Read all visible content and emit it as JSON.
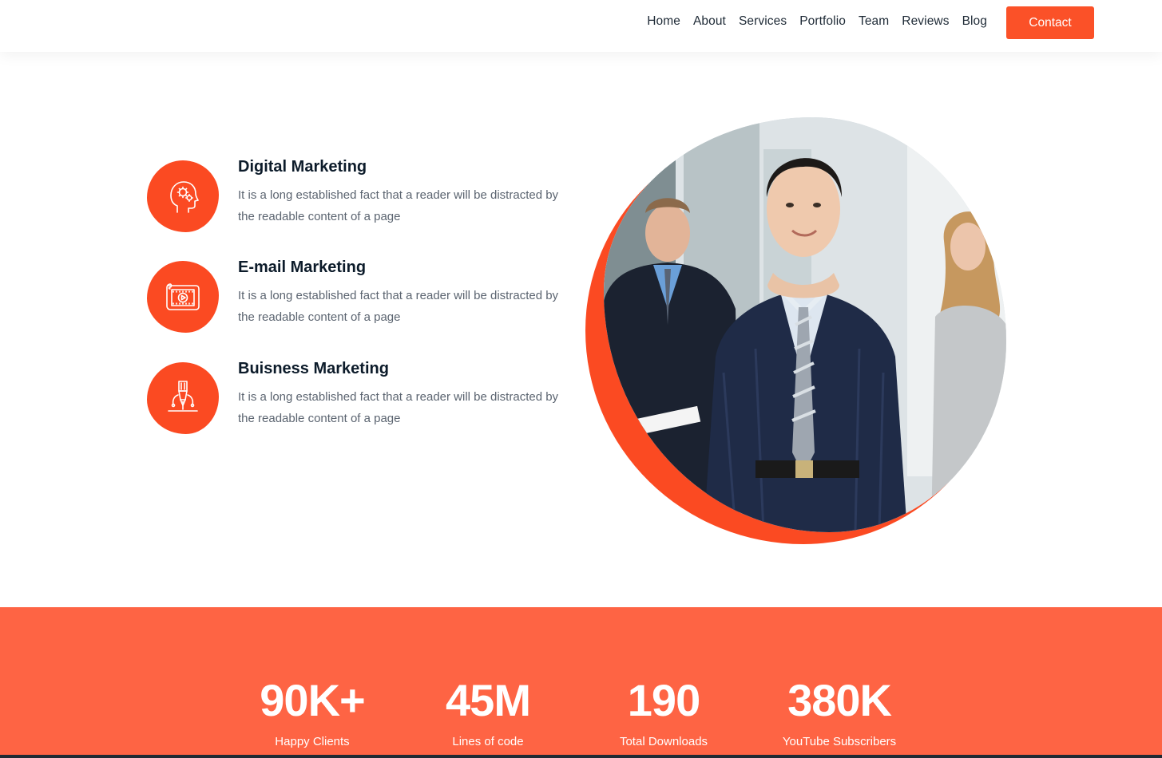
{
  "nav": {
    "links": [
      "Home",
      "About",
      "Services",
      "Portfolio",
      "Team",
      "Reviews",
      "Blog"
    ],
    "contact_label": "Contact"
  },
  "services": [
    {
      "title": "Digital Marketing",
      "description": "It is a long established fact that a reader will be distracted by the readable content of a page",
      "icon": "head-gears-icon"
    },
    {
      "title": "E-mail Marketing",
      "description": "It is a long established fact that a reader will be distracted by the readable content of a page",
      "icon": "video-film-icon"
    },
    {
      "title": "Buisness Marketing",
      "description": "It is a long established fact that a reader will be distracted by the readable content of a page",
      "icon": "pen-nib-idea-icon"
    }
  ],
  "stats": [
    {
      "value": "90K+",
      "label": "Happy Clients"
    },
    {
      "value": "45M",
      "label": "Lines of code"
    },
    {
      "value": "190",
      "label": "Total Downloads"
    },
    {
      "value": "380K",
      "label": "YouTube Subscribers"
    }
  ],
  "colors": {
    "accent": "#fb5128",
    "icon_bg": "#fb4a22",
    "stats_bg": "#fe6444",
    "heading": "#0c1b2a",
    "body_text": "#5b6470"
  }
}
